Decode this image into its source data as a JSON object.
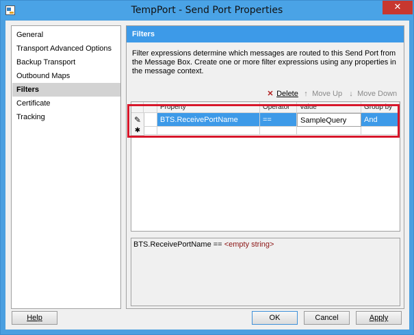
{
  "window": {
    "title": "TempPort - Send Port Properties",
    "close_glyph": "✕"
  },
  "sidebar": {
    "items": [
      {
        "label": "General",
        "active": false
      },
      {
        "label": "Transport Advanced Options",
        "active": false
      },
      {
        "label": "Backup Transport",
        "active": false
      },
      {
        "label": "Outbound Maps",
        "active": false
      },
      {
        "label": "Filters",
        "active": true
      },
      {
        "label": "Certificate",
        "active": false
      },
      {
        "label": "Tracking",
        "active": false
      }
    ]
  },
  "panel": {
    "header": "Filters",
    "description": "Filter expressions determine which messages are routed to this Send Port from the Message Box. Create one or more filter expressions using any properties in the message context.",
    "toolbar": {
      "delete_label": "Delete",
      "move_up_label": "Move Up",
      "move_down_label": "Move Down"
    },
    "grid": {
      "columns": [
        "Property",
        "Operator",
        "Value",
        "Group by"
      ],
      "rows": [
        {
          "property": "BTS.ReceivePortName",
          "operator": "==",
          "value": "SampleQuery",
          "group_by": "And"
        }
      ],
      "edit_row_glyph": "✎",
      "new_row_glyph": "✱"
    },
    "summary": {
      "expression": "BTS.ReceivePortName ==",
      "empty_value": "<empty string>"
    }
  },
  "buttons": {
    "help": "Help",
    "ok": "OK",
    "cancel": "Cancel",
    "apply": "Apply"
  },
  "colors": {
    "accent": "#3d9ae8",
    "highlight_border": "#d7162a",
    "close_button": "#c7372f"
  }
}
